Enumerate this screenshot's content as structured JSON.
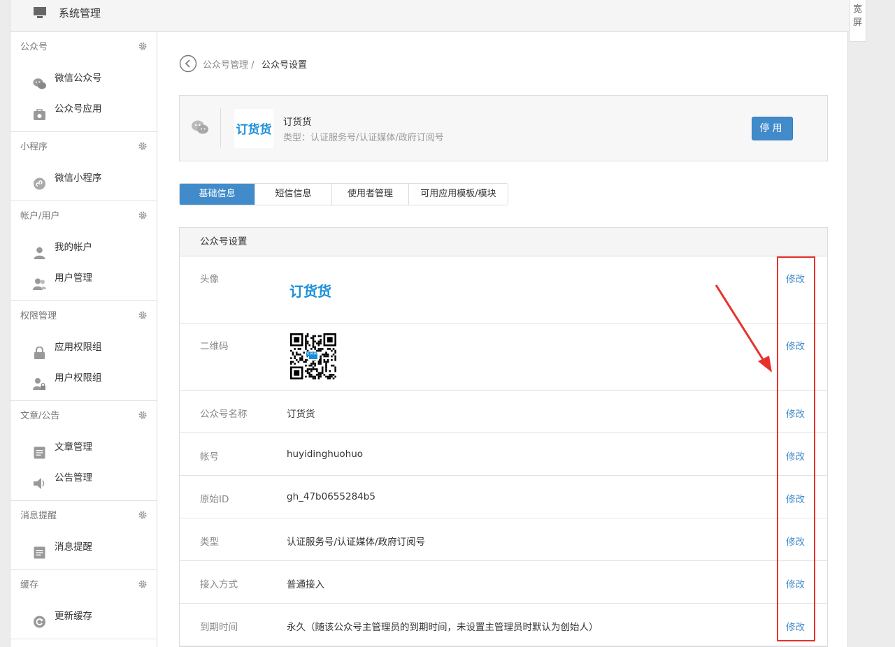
{
  "topbar": {
    "title": "系统管理",
    "wide_label": "宽屏"
  },
  "sidebar": {
    "groups": [
      {
        "title": "公众号",
        "items": [
          {
            "label": "微信公众号",
            "icon": "wechat-icon"
          },
          {
            "label": "公众号应用",
            "icon": "bag-icon"
          }
        ]
      },
      {
        "title": "小程序",
        "items": [
          {
            "label": "微信小程序",
            "icon": "miniprogram-icon"
          }
        ]
      },
      {
        "title": "帐户/用户",
        "items": [
          {
            "label": "我的帐户",
            "icon": "user-icon"
          },
          {
            "label": "用户管理",
            "icon": "users-icon"
          }
        ]
      },
      {
        "title": "权限管理",
        "items": [
          {
            "label": "应用权限组",
            "icon": "lock-icon"
          },
          {
            "label": "用户权限组",
            "icon": "user-lock-icon"
          }
        ]
      },
      {
        "title": "文章/公告",
        "items": [
          {
            "label": "文章管理",
            "icon": "document-icon"
          },
          {
            "label": "公告管理",
            "icon": "speaker-icon"
          }
        ]
      },
      {
        "title": "消息提醒",
        "items": [
          {
            "label": "消息提醒",
            "icon": "document-icon"
          }
        ]
      },
      {
        "title": "缓存",
        "items": [
          {
            "label": "更新缓存",
            "icon": "refresh-icon"
          }
        ]
      }
    ]
  },
  "breadcrumb": {
    "parent": "公众号管理 /",
    "current": "公众号设置"
  },
  "account": {
    "name": "订货货",
    "type": "类型：认证服务号/认证媒体/政府订阅号",
    "logo_text": "订货货",
    "stop_label": "停用"
  },
  "tabs": [
    "基础信息",
    "短信信息",
    "使用者管理",
    "可用应用模板/模块"
  ],
  "panel": {
    "title": "公众号设置",
    "edit_label": "修改",
    "rows": [
      {
        "label": "头像",
        "kind": "logo",
        "value": "订货货"
      },
      {
        "label": "二维码",
        "kind": "qr",
        "value": "订货货"
      },
      {
        "label": "公众号名称",
        "kind": "text",
        "value": "订货货"
      },
      {
        "label": "帐号",
        "kind": "text",
        "value": "huyidinghuohuo"
      },
      {
        "label": "原始ID",
        "kind": "text",
        "value": "gh_47b0655284b5"
      },
      {
        "label": "类型",
        "kind": "text",
        "value": "认证服务号/认证媒体/政府订阅号"
      },
      {
        "label": "接入方式",
        "kind": "text",
        "value": "普通接入"
      },
      {
        "label": "到期时间",
        "kind": "text",
        "value": "永久（随该公众号主管理员的到期时间，未设置主管理员时默认为创始人）"
      }
    ]
  },
  "colors": {
    "accent": "#428bca",
    "annotation": "#e8312c",
    "brand": "#1a8fd8"
  }
}
